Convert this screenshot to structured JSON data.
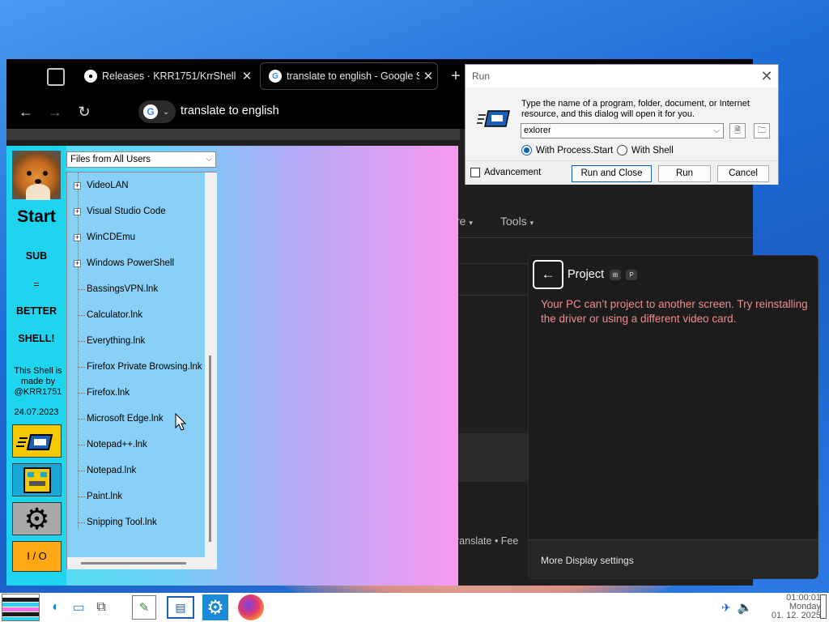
{
  "browser": {
    "tabs": [
      {
        "title": "Releases · KRR1751/KrrShell",
        "icon": "github-icon"
      },
      {
        "title": "translate to english - Google Se",
        "icon": "google-icon"
      }
    ],
    "close_glyph": "✕",
    "newtab_glyph": "+",
    "address_text": "translate to english",
    "page_tools": "Tools",
    "page_more": "re",
    "page_footer": "ranslate  •  Fee"
  },
  "shell": {
    "start_label": "Start",
    "sub_label": "SUB",
    "equals_label": "=",
    "better_label": "BETTER",
    "shell_label": "SHELL!",
    "made_by": "This Shell is made by @KRR1751",
    "date": "24.07.2023",
    "io_label": "I / O",
    "folder_select": "Files from All Users",
    "tree_items": [
      {
        "label": "VideoLAN",
        "expandable": true
      },
      {
        "label": "Visual Studio Code",
        "expandable": true
      },
      {
        "label": "WinCDEmu",
        "expandable": true
      },
      {
        "label": "Windows PowerShell",
        "expandable": true
      },
      {
        "label": "BassingsVPN.lnk",
        "expandable": false
      },
      {
        "label": "Calculator.lnk",
        "expandable": false
      },
      {
        "label": "Everything.lnk",
        "expandable": false
      },
      {
        "label": "Firefox Private Browsing.lnk",
        "expandable": false
      },
      {
        "label": "Firefox.lnk",
        "expandable": false
      },
      {
        "label": "Microsoft Edge.lnk",
        "expandable": false
      },
      {
        "label": "Notepad++.lnk",
        "expandable": false
      },
      {
        "label": "Notepad.lnk",
        "expandable": false
      },
      {
        "label": "Paint.lnk",
        "expandable": false
      },
      {
        "label": "Snipping Tool.lnk",
        "expandable": false
      }
    ]
  },
  "run_dialog": {
    "title": "Run",
    "description": "Type the name of a program, folder, document, or Internet resource, and this dialog will open it for you.",
    "input_value": "exlorer",
    "radio_process_start": "With Process.Start",
    "radio_shell": "With Shell",
    "selected_radio": "With Process.Start",
    "advancement_label": "Advancement",
    "btn_run_close": "Run and Close",
    "btn_run": "Run",
    "btn_cancel": "Cancel"
  },
  "project_pane": {
    "title": "Project",
    "shortcut_keys": [
      "⊞",
      "P"
    ],
    "message": "Your PC can’t project to another screen. Try reinstalling the driver or using a different video card.",
    "footer": "More Display settings"
  },
  "taskbar": {
    "clock_time": "01:00:01",
    "clock_day": "Monday",
    "clock_date": "01. 12. 2025"
  },
  "colors": {
    "shell_side": "#1ed4ee",
    "run_button_yellow": "#f5c800",
    "io_orange": "#ffa814",
    "project_error_text": "#f28b8b"
  }
}
